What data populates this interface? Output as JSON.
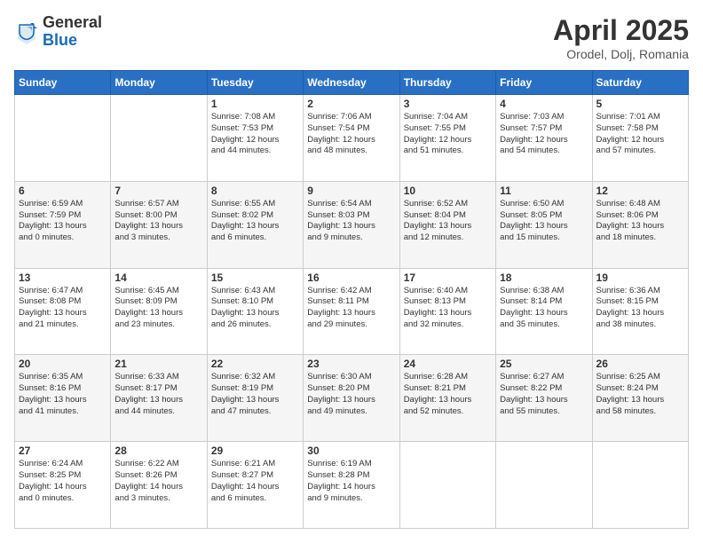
{
  "header": {
    "logo_general": "General",
    "logo_blue": "Blue",
    "title": "April 2025",
    "location": "Orodel, Dolj, Romania"
  },
  "weekdays": [
    "Sunday",
    "Monday",
    "Tuesday",
    "Wednesday",
    "Thursday",
    "Friday",
    "Saturday"
  ],
  "weeks": [
    [
      {
        "day": "",
        "info": ""
      },
      {
        "day": "",
        "info": ""
      },
      {
        "day": "1",
        "info": "Sunrise: 7:08 AM\nSunset: 7:53 PM\nDaylight: 12 hours\nand 44 minutes."
      },
      {
        "day": "2",
        "info": "Sunrise: 7:06 AM\nSunset: 7:54 PM\nDaylight: 12 hours\nand 48 minutes."
      },
      {
        "day": "3",
        "info": "Sunrise: 7:04 AM\nSunset: 7:55 PM\nDaylight: 12 hours\nand 51 minutes."
      },
      {
        "day": "4",
        "info": "Sunrise: 7:03 AM\nSunset: 7:57 PM\nDaylight: 12 hours\nand 54 minutes."
      },
      {
        "day": "5",
        "info": "Sunrise: 7:01 AM\nSunset: 7:58 PM\nDaylight: 12 hours\nand 57 minutes."
      }
    ],
    [
      {
        "day": "6",
        "info": "Sunrise: 6:59 AM\nSunset: 7:59 PM\nDaylight: 13 hours\nand 0 minutes."
      },
      {
        "day": "7",
        "info": "Sunrise: 6:57 AM\nSunset: 8:00 PM\nDaylight: 13 hours\nand 3 minutes."
      },
      {
        "day": "8",
        "info": "Sunrise: 6:55 AM\nSunset: 8:02 PM\nDaylight: 13 hours\nand 6 minutes."
      },
      {
        "day": "9",
        "info": "Sunrise: 6:54 AM\nSunset: 8:03 PM\nDaylight: 13 hours\nand 9 minutes."
      },
      {
        "day": "10",
        "info": "Sunrise: 6:52 AM\nSunset: 8:04 PM\nDaylight: 13 hours\nand 12 minutes."
      },
      {
        "day": "11",
        "info": "Sunrise: 6:50 AM\nSunset: 8:05 PM\nDaylight: 13 hours\nand 15 minutes."
      },
      {
        "day": "12",
        "info": "Sunrise: 6:48 AM\nSunset: 8:06 PM\nDaylight: 13 hours\nand 18 minutes."
      }
    ],
    [
      {
        "day": "13",
        "info": "Sunrise: 6:47 AM\nSunset: 8:08 PM\nDaylight: 13 hours\nand 21 minutes."
      },
      {
        "day": "14",
        "info": "Sunrise: 6:45 AM\nSunset: 8:09 PM\nDaylight: 13 hours\nand 23 minutes."
      },
      {
        "day": "15",
        "info": "Sunrise: 6:43 AM\nSunset: 8:10 PM\nDaylight: 13 hours\nand 26 minutes."
      },
      {
        "day": "16",
        "info": "Sunrise: 6:42 AM\nSunset: 8:11 PM\nDaylight: 13 hours\nand 29 minutes."
      },
      {
        "day": "17",
        "info": "Sunrise: 6:40 AM\nSunset: 8:13 PM\nDaylight: 13 hours\nand 32 minutes."
      },
      {
        "day": "18",
        "info": "Sunrise: 6:38 AM\nSunset: 8:14 PM\nDaylight: 13 hours\nand 35 minutes."
      },
      {
        "day": "19",
        "info": "Sunrise: 6:36 AM\nSunset: 8:15 PM\nDaylight: 13 hours\nand 38 minutes."
      }
    ],
    [
      {
        "day": "20",
        "info": "Sunrise: 6:35 AM\nSunset: 8:16 PM\nDaylight: 13 hours\nand 41 minutes."
      },
      {
        "day": "21",
        "info": "Sunrise: 6:33 AM\nSunset: 8:17 PM\nDaylight: 13 hours\nand 44 minutes."
      },
      {
        "day": "22",
        "info": "Sunrise: 6:32 AM\nSunset: 8:19 PM\nDaylight: 13 hours\nand 47 minutes."
      },
      {
        "day": "23",
        "info": "Sunrise: 6:30 AM\nSunset: 8:20 PM\nDaylight: 13 hours\nand 49 minutes."
      },
      {
        "day": "24",
        "info": "Sunrise: 6:28 AM\nSunset: 8:21 PM\nDaylight: 13 hours\nand 52 minutes."
      },
      {
        "day": "25",
        "info": "Sunrise: 6:27 AM\nSunset: 8:22 PM\nDaylight: 13 hours\nand 55 minutes."
      },
      {
        "day": "26",
        "info": "Sunrise: 6:25 AM\nSunset: 8:24 PM\nDaylight: 13 hours\nand 58 minutes."
      }
    ],
    [
      {
        "day": "27",
        "info": "Sunrise: 6:24 AM\nSunset: 8:25 PM\nDaylight: 14 hours\nand 0 minutes."
      },
      {
        "day": "28",
        "info": "Sunrise: 6:22 AM\nSunset: 8:26 PM\nDaylight: 14 hours\nand 3 minutes."
      },
      {
        "day": "29",
        "info": "Sunrise: 6:21 AM\nSunset: 8:27 PM\nDaylight: 14 hours\nand 6 minutes."
      },
      {
        "day": "30",
        "info": "Sunrise: 6:19 AM\nSunset: 8:28 PM\nDaylight: 14 hours\nand 9 minutes."
      },
      {
        "day": "",
        "info": ""
      },
      {
        "day": "",
        "info": ""
      },
      {
        "day": "",
        "info": ""
      }
    ]
  ]
}
